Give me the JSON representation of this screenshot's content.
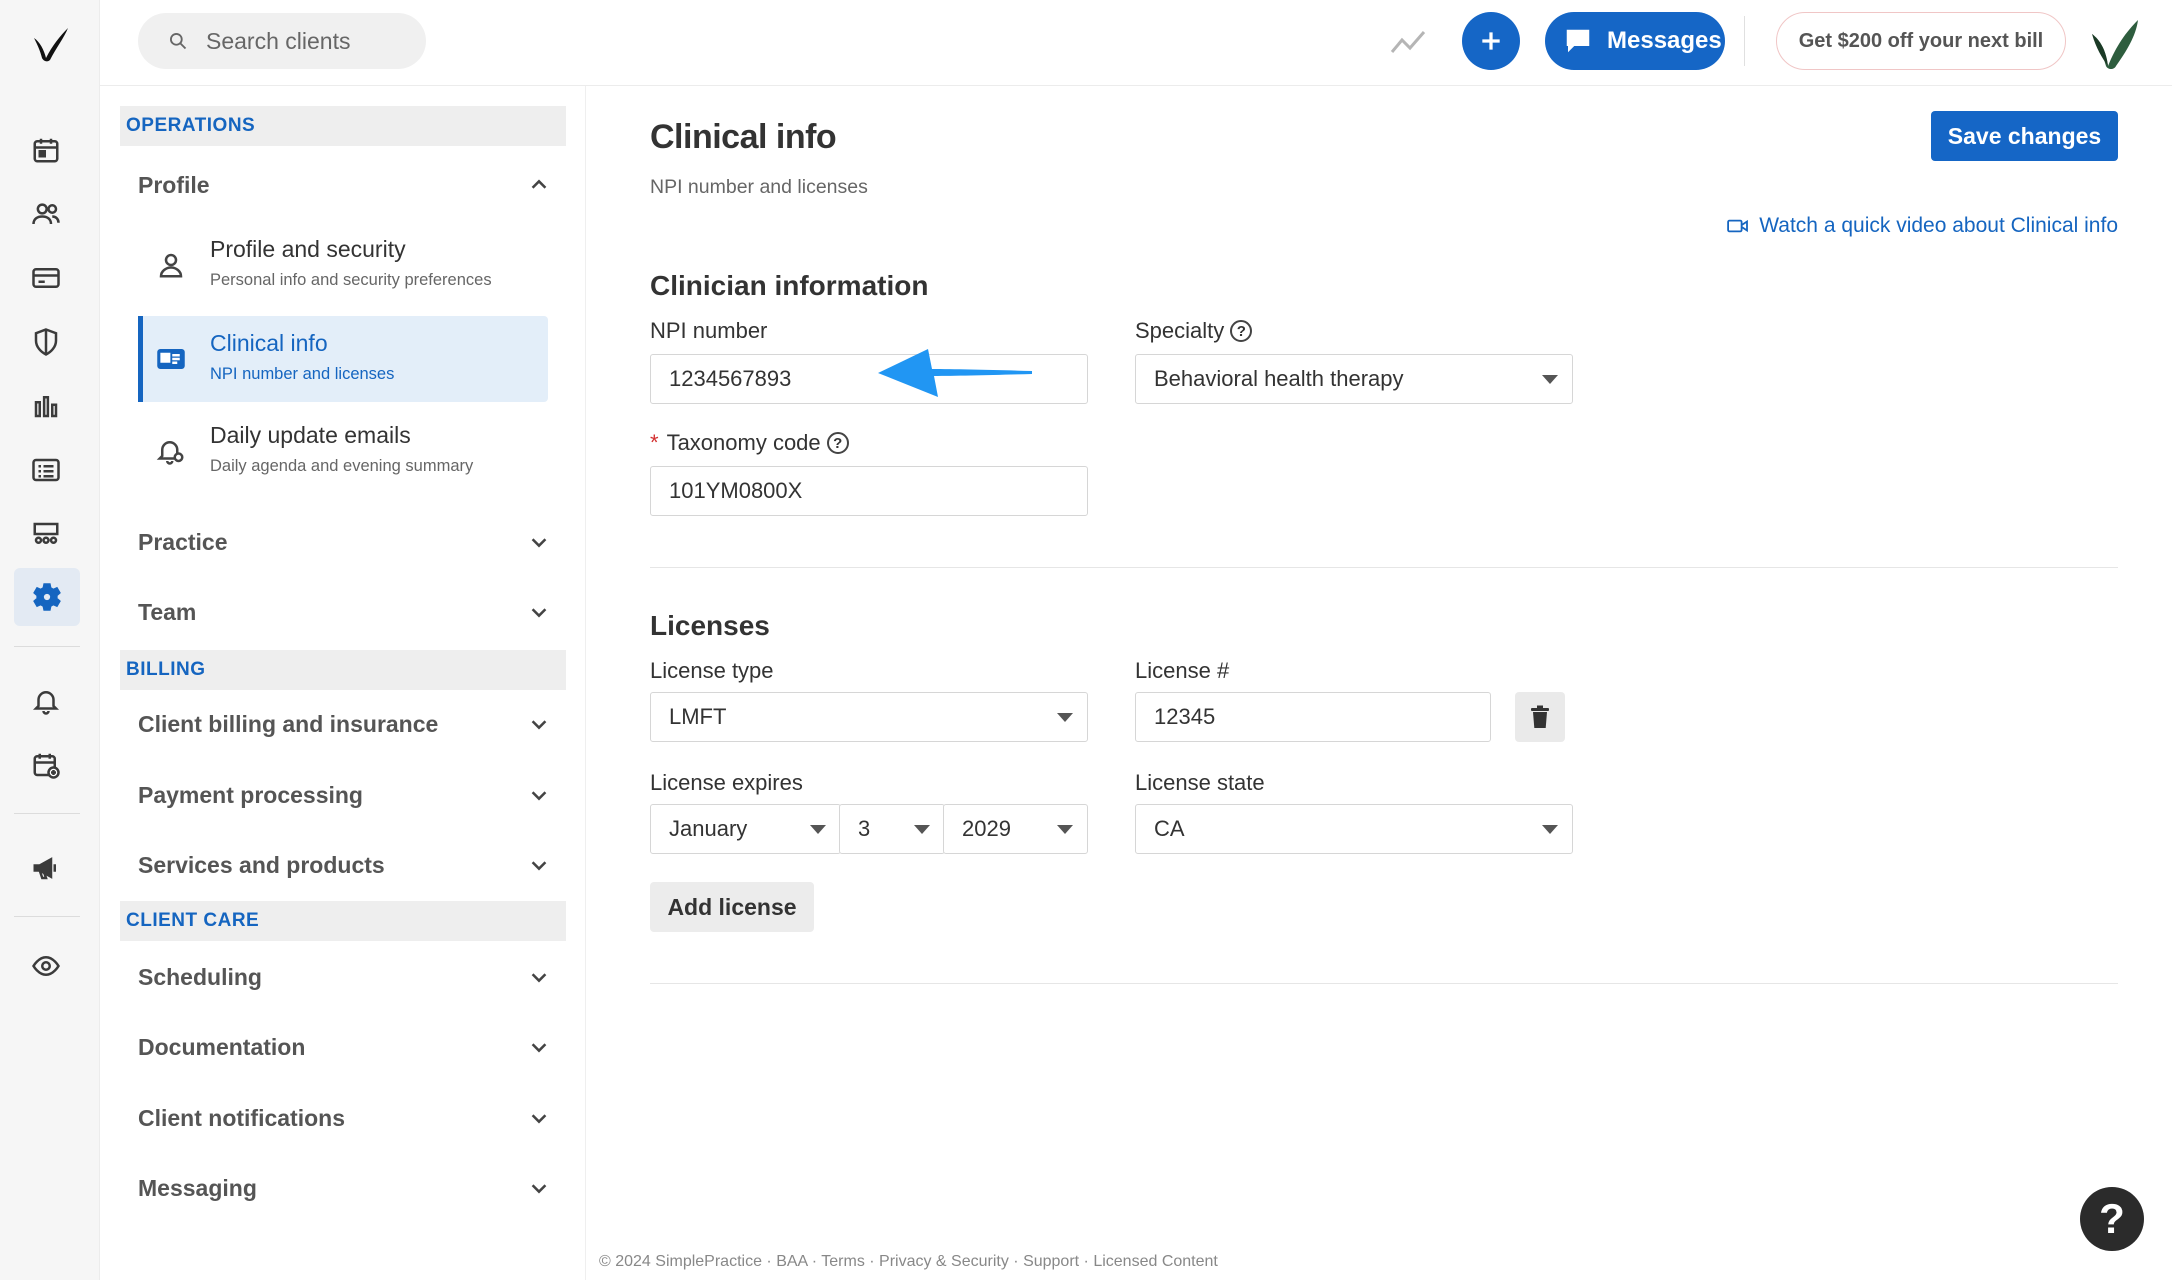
{
  "search": {
    "placeholder": "Search clients"
  },
  "header": {
    "messages_label": "Messages",
    "promo_label": "Get $200 off your next bill"
  },
  "nav": {
    "operations": "OPERATIONS",
    "profile": "Profile",
    "profile_security": {
      "title": "Profile and security",
      "desc": "Personal info and security preferences"
    },
    "clinical_info": {
      "title": "Clinical info",
      "desc": "NPI number and licenses"
    },
    "daily_emails": {
      "title": "Daily update emails",
      "desc": "Daily agenda and evening summary"
    },
    "practice": "Practice",
    "team": "Team",
    "billing": "BILLING",
    "client_billing": "Client billing and insurance",
    "payment": "Payment processing",
    "services": "Services and products",
    "client_care": "CLIENT CARE",
    "scheduling": "Scheduling",
    "documentation": "Documentation",
    "client_notifications": "Client notifications",
    "messaging": "Messaging"
  },
  "main": {
    "title": "Clinical info",
    "subtitle": "NPI number and licenses",
    "save_label": "Save changes",
    "video_link": "Watch a quick video about Clinical info",
    "clinician_heading": "Clinician information",
    "npi_label": "NPI number",
    "npi_value": "1234567893",
    "specialty_label": "Specialty",
    "specialty_value": "Behavioral health therapy",
    "taxonomy_label": "Taxonomy code",
    "taxonomy_value": "101YM0800X",
    "licenses_heading": "Licenses",
    "license_type_label": "License type",
    "license_type_value": "LMFT",
    "license_num_label": "License #",
    "license_num_value": "12345",
    "license_expires_label": "License expires",
    "expires_month": "January",
    "expires_day": "3",
    "expires_year": "2029",
    "license_state_label": "License state",
    "license_state_value": "CA",
    "add_license_label": "Add license",
    "help_mark": "?",
    "required_mark": "*"
  },
  "footer": {
    "text": "© 2024 SimplePractice · BAA · Terms · Privacy & Security · Support · Licensed Content"
  },
  "colors": {
    "accent": "#1566c6",
    "active_bg": "#e3eef9",
    "arrow": "#2196f3"
  }
}
